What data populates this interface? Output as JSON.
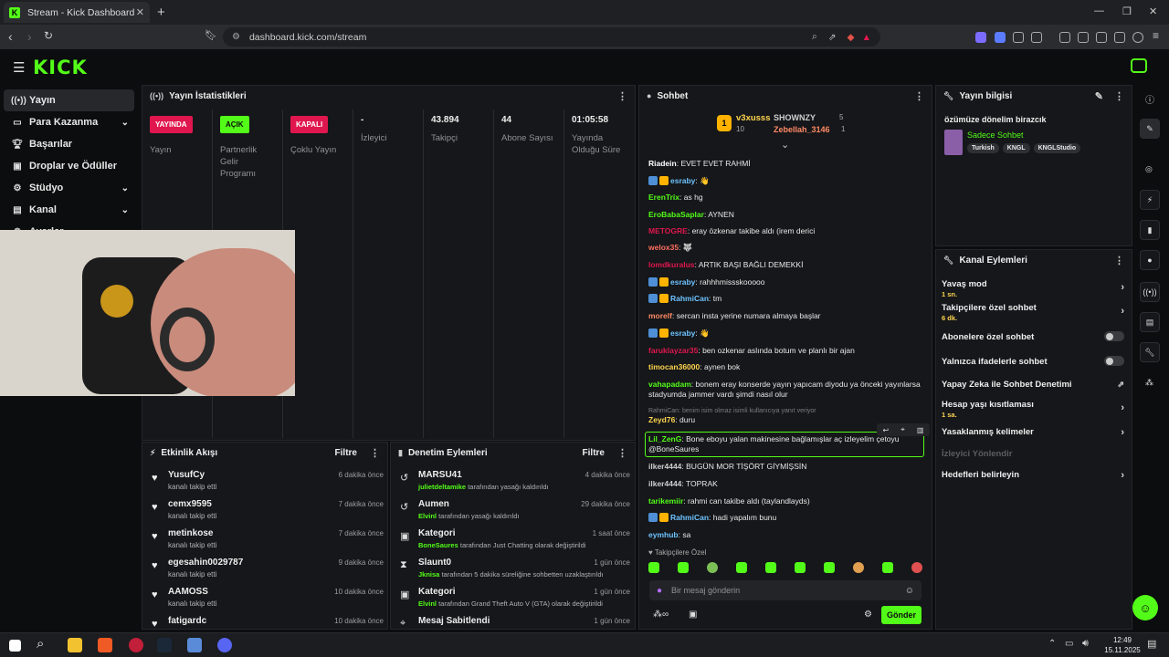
{
  "browser": {
    "tab_title": "Stream - Kick Dashboard",
    "url": "dashboard.kick.com/stream"
  },
  "brand": {
    "logo": "KICK",
    "accent": "#53fc18"
  },
  "sidebar": {
    "items": [
      {
        "label": "Yayın",
        "icon": "broadcast-icon",
        "active": true
      },
      {
        "label": "Para Kazanma",
        "icon": "money-icon",
        "chevron": true
      },
      {
        "label": "Başarılar",
        "icon": "trophy-icon"
      },
      {
        "label": "Droplar ve Ödüller",
        "icon": "gift-icon"
      },
      {
        "label": "Stüdyo",
        "icon": "sliders-icon",
        "chevron": true
      },
      {
        "label": "Kanal",
        "icon": "channel-icon",
        "chevron": true
      },
      {
        "label": "Ayarlar",
        "icon": "gear-icon",
        "chevron": true
      }
    ]
  },
  "stats": {
    "title": "Yayın İstatistikleri",
    "cols": [
      {
        "badge": "YAYINDA",
        "badge_color": "#e0174e",
        "label": "Yayın"
      },
      {
        "badge": "AÇIK",
        "badge_color": "#53fc18",
        "label": "Partnerlik Gelir Programı"
      },
      {
        "badge": "KAPALI",
        "badge_color": "#e0174e",
        "label": "Çoklu Yayın"
      },
      {
        "value": "-",
        "label": "İzleyici"
      },
      {
        "value": "43.894",
        "label": "Takipçi"
      },
      {
        "value": "44",
        "label": "Abone Sayısı"
      },
      {
        "value": "01:05:58",
        "label": "Yayında Olduğu Süre"
      }
    ]
  },
  "activity": {
    "title": "Etkinlik Akışı",
    "filter": "Filtre",
    "rows": [
      {
        "name": "YusufCy",
        "sub": "kanalı takip etti",
        "time": "6 dakika önce"
      },
      {
        "name": "cemx9595",
        "sub": "kanalı takip etti",
        "time": "7 dakika önce"
      },
      {
        "name": "metinkose",
        "sub": "kanalı takip etti",
        "time": "7 dakika önce"
      },
      {
        "name": "egesahin0029787",
        "sub": "kanalı takip etti",
        "time": "9 dakika önce"
      },
      {
        "name": "AAMOSS",
        "sub": "kanalı takip etti",
        "time": "10 dakika önce"
      },
      {
        "name": "fatigardc",
        "sub": "",
        "time": "10 dakika önce"
      }
    ]
  },
  "moderation": {
    "title": "Denetim Eylemleri",
    "filter": "Filtre",
    "rows": [
      {
        "name": "MARSU41",
        "by": "julietdeltamike",
        "rest": " tarafından yasağı kaldırıldı",
        "time": "4 dakika önce",
        "icon": "undo-icon"
      },
      {
        "name": "Aumen",
        "by": "Elvinl",
        "rest": " tarafından yasağı kaldırıldı",
        "time": "29 dakika önce",
        "icon": "undo-icon"
      },
      {
        "name": "Kategori",
        "by": "BoneSaures",
        "rest": " tarafından Just Chatting olarak değiştirildi",
        "time": "1 saat önce",
        "icon": "category-icon"
      },
      {
        "name": "Slaunt0",
        "by": "Jknisa",
        "rest": " tarafından 5 dakika süreliğine sohbetten uzaklaştırıldı",
        "time": "1 gün önce",
        "icon": "hourglass-icon"
      },
      {
        "name": "Kategori",
        "by": "Elvinl",
        "rest": " tarafından Grand Theft Auto V (GTA) olarak değiştirildi",
        "time": "1 gün önce",
        "icon": "category-icon"
      },
      {
        "name": "Mesaj Sabitlendi",
        "by": "",
        "rest": "",
        "time": "1 gün önce",
        "icon": "pin-icon"
      }
    ]
  },
  "chat": {
    "title": "Sohbet",
    "leaders": [
      {
        "name": "v3xusss",
        "count": "10"
      },
      {
        "name": "SHOWNZY",
        "count": "5"
      },
      {
        "name": "Zebellah_3146",
        "count": "1"
      }
    ],
    "messages": [
      {
        "user": "Riadein",
        "color": "#ffffff",
        "text": "EVET EVET RAHMİ"
      },
      {
        "user": "esraby",
        "color": "#6ec3ff",
        "text": "👋",
        "badges": 2
      },
      {
        "user": "ErenTrix",
        "color": "#53fc18",
        "text": "as hg"
      },
      {
        "user": "EroBabaSaplar",
        "color": "#53fc18",
        "text": "AYNEN"
      },
      {
        "user": "METOGRE",
        "color": "#e0174e",
        "text": "eray özkenar takibe aldı (irem derici"
      },
      {
        "user": "welox35",
        "color": "#ff6f61",
        "text": "🐺"
      },
      {
        "user": "lomdkuralus",
        "color": "#e0174e",
        "text": "ARTIK BAŞI BAĞLI DEMEKKİ"
      },
      {
        "user": "esraby",
        "color": "#6ec3ff",
        "text": "rahhhmissskooooo",
        "badges": 2
      },
      {
        "user": "RahmiCan",
        "color": "#6ec3ff",
        "text": "tm",
        "badges": 2
      },
      {
        "user": "morelf",
        "color": "#ff8a65",
        "text": "sercan insta yerine numara almaya başlar"
      },
      {
        "user": "esraby",
        "color": "#6ec3ff",
        "text": "👋",
        "badges": 2
      },
      {
        "user": "faruklayzar35",
        "color": "#e0174e",
        "text": "ben ozkenar aslında botum ve planlı bir ajan"
      },
      {
        "user": "timocan36000",
        "color": "#ffd54f",
        "text": "aynen bok"
      },
      {
        "user": "vahapadam",
        "color": "#53fc18",
        "text": "bonem eray konserde yayın yapıcam diyodu ya önceki yayınlarsa stadyumda jammer vardı şimdi nasıl olur"
      },
      {
        "user": "Zeyd76",
        "color": "#ffd54f",
        "text": "duru",
        "reply": "RahmiCan: benim isim olmaz isimli kullanıcıya yanıt veriyor"
      },
      {
        "user": "Lil_ZenG",
        "color": "#53fc18",
        "text": "Bone eboyu yalan makinesine bağlamışlar aç izleyelim çetoyu @BoneSaures",
        "highlight": true
      },
      {
        "user": "ilker4444",
        "color": "#cfcfcf",
        "text": "BUGÜN MOR TİŞÖRT GİYMİŞSİN"
      },
      {
        "user": "ilker4444",
        "color": "#cfcfcf",
        "text": "TOPRAK"
      },
      {
        "user": "tarikemiir",
        "color": "#53fc18",
        "text": "rahmi can takibe aldı (taylandlayds)"
      },
      {
        "user": "RahmiCan",
        "color": "#6ec3ff",
        "text": "hadi yapalım bunu",
        "badges": 2
      },
      {
        "user": "eymhub",
        "color": "#6ec3ff",
        "text": "sa"
      }
    ],
    "subscribers_only": "Takipçilere Özel",
    "input_placeholder": "Bir mesaj gönderin",
    "send_label": "Gönder"
  },
  "streaminfo": {
    "title": "Yayın bilgisi",
    "stream_title": "özümüze dönelim birazcık",
    "category": "Sadece Sohbet",
    "tags": [
      "Turkish",
      "KNGL",
      "KNGLStudio"
    ]
  },
  "channel_actions": {
    "title": "Kanal Eylemleri",
    "items": [
      {
        "label": "Yavaş mod",
        "sub": "1 sn.",
        "control": "chevron"
      },
      {
        "label": "Takipçilere özel sohbet",
        "sub": "6 dk.",
        "control": "chevron"
      },
      {
        "label": "Abonelere özel sohbet",
        "control": "toggle"
      },
      {
        "label": "Yalnızca ifadelerle sohbet",
        "control": "toggle"
      },
      {
        "label": "Yapay Zeka ile Sohbet Denetimi",
        "control": "external"
      },
      {
        "label": "Hesap yaşı kısıtlaması",
        "sub": "1 sa.",
        "control": "chevron"
      },
      {
        "label": "Yasaklanmış kelimeler",
        "control": "chevron"
      },
      {
        "label": "İzleyici Yönlendir",
        "control": "none",
        "disabled": true
      },
      {
        "label": "Hedefleri belirleyin",
        "control": "chevron"
      }
    ]
  },
  "taskbar": {
    "time": "12:49",
    "date": "15.11.2025"
  }
}
